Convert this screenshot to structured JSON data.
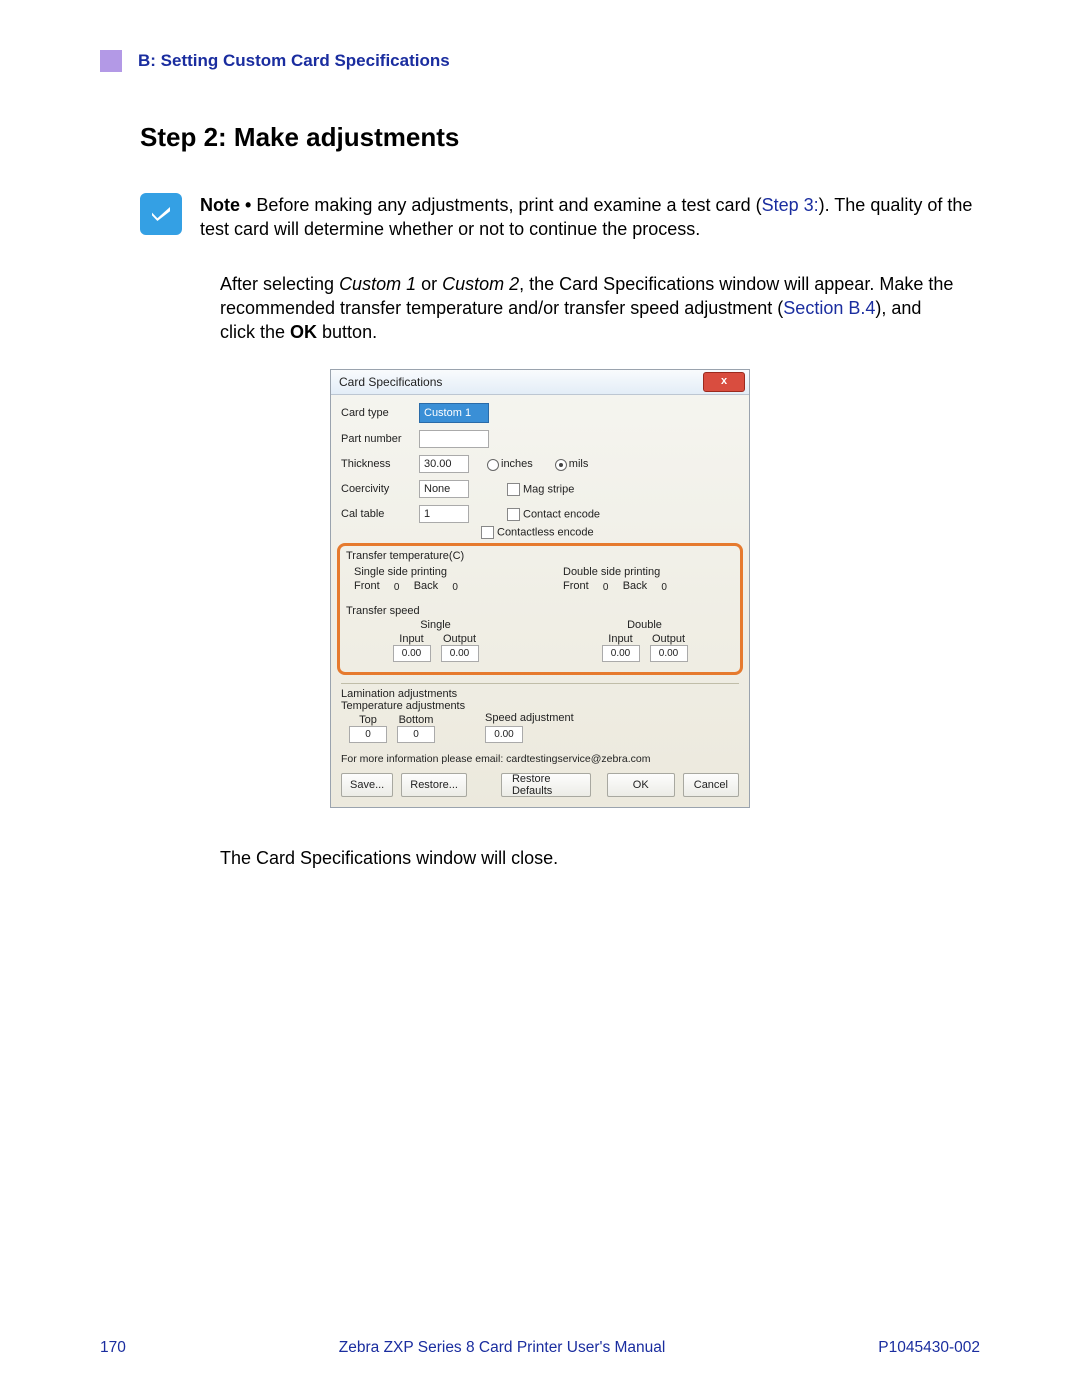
{
  "header": {
    "section": "B: Setting Custom Card Specifications"
  },
  "step": {
    "title": "Step 2: Make adjustments"
  },
  "note": {
    "label": "Note • ",
    "text1": "Before making any adjustments, print and examine a test card (",
    "link1": "Step 3:",
    "text2": "). The quality of the test card will determine whether or not to continue the process."
  },
  "body": {
    "p1a": "After selecting ",
    "c1": "Custom 1",
    "p1b": " or ",
    "c2": "Custom 2",
    "p1c": ", the Card Specifications window will appear. Make the recommended transfer temperature and/or transfer speed adjustment (",
    "link2": "Section B.4",
    "p1d": "), and click the ",
    "ok": "OK",
    "p1e": " button."
  },
  "dialog": {
    "title": "Card Specifications",
    "close": "x",
    "rows": {
      "cardtype": "Card type",
      "cardtype_val": "Custom 1",
      "partnumber": "Part number",
      "thickness": "Thickness",
      "thickness_val": "30.00",
      "inches": "inches",
      "mils": "mils",
      "coercivity": "Coercivity",
      "coercivity_val": "None",
      "magstripe": "Mag stripe",
      "caltable": "Cal table",
      "caltable_val": "1",
      "contact": "Contact encode",
      "contactless": "Contactless encode"
    },
    "transfer_temp": {
      "label": "Transfer temperature(C)",
      "single": "Single side printing",
      "double": "Double side printing",
      "front": "Front",
      "back": "Back",
      "zero": "0"
    },
    "transfer_speed": {
      "label": "Transfer speed",
      "single": "Single",
      "double": "Double",
      "input": "Input",
      "output": "Output",
      "val": "0.00"
    },
    "lam": {
      "label": "Lamination adjustments",
      "temp": "Temperature adjustments",
      "top": "Top",
      "bottom": "Bottom",
      "top_val": "0",
      "bottom_val": "0",
      "speed": "Speed adjustment",
      "speed_val": "0.00"
    },
    "info": "For more information  please email: cardtestingservice@zebra.com",
    "buttons": {
      "save": "Save...",
      "restore": "Restore...",
      "defaults": "Restore Defaults",
      "ok": "OK",
      "cancel": "Cancel"
    }
  },
  "after": "The Card Specifications window will close.",
  "footer": {
    "page": "170",
    "manual": "Zebra ZXP Series 8 Card Printer User's Manual",
    "doc": "P1045430-002"
  }
}
